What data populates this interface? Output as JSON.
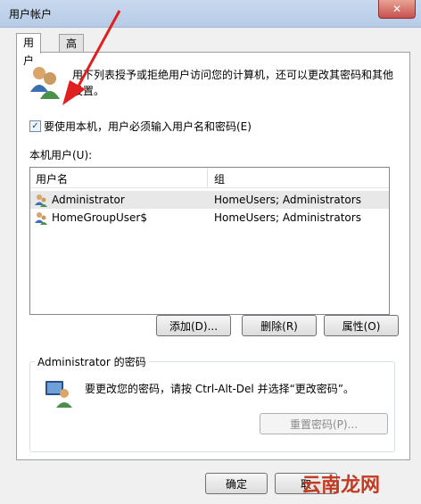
{
  "window": {
    "title": "用户帐户",
    "close_label": "✕"
  },
  "tabs": [
    {
      "label": "用户"
    },
    {
      "label": "高级"
    }
  ],
  "description": "用下列表授予或拒绝用户访问您的计算机，还可以更改其密码和其他设置。",
  "require_login": {
    "checked": true,
    "label": "要使用本机，用户必须输入用户名和密码(E)"
  },
  "local_users": {
    "label": "本机用户(U):",
    "columns": [
      "用户名",
      "组"
    ],
    "rows": [
      {
        "name": "Administrator",
        "group": "HomeUsers; Administrators"
      },
      {
        "name": "HomeGroupUser$",
        "group": "HomeUsers; Administrators"
      }
    ]
  },
  "buttons": {
    "add": "添加(D)...",
    "remove": "删除(R)",
    "properties": "属性(O)"
  },
  "password_group": {
    "title": "Administrator 的密码",
    "text": "要更改您的密码，请按 Ctrl-Alt-Del 并选择“更改密码”。",
    "reset_button": "重置密码(P)..."
  },
  "footer": {
    "ok": "确定",
    "cancel": "取"
  },
  "watermark": "云南龙网",
  "colors": {
    "annotation_arrow": "#e02020",
    "watermark": "#c23b22"
  }
}
